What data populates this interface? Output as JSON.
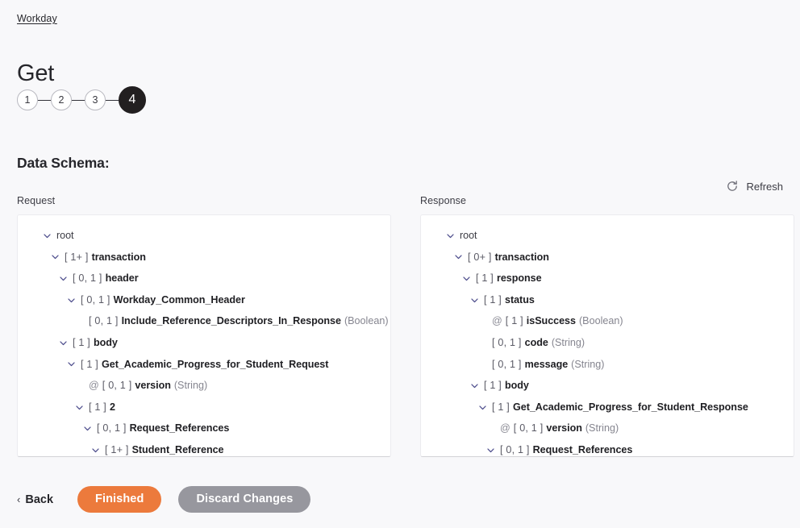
{
  "breadcrumb": {
    "label": "Workday"
  },
  "title": "Get",
  "stepper": {
    "steps": [
      {
        "label": "1",
        "active": false
      },
      {
        "label": "2",
        "active": false
      },
      {
        "label": "3",
        "active": false
      },
      {
        "label": "4",
        "active": true
      }
    ]
  },
  "section": {
    "heading": "Data Schema:"
  },
  "toolbar": {
    "refresh_label": "Refresh",
    "refresh_icon": "refresh-icon"
  },
  "colors": {
    "page_background": "#f8f8fa",
    "panel_background": "#ffffff",
    "accent_primary": "#ec7a3c",
    "accent_secondary": "#97979e",
    "active_step": "#221f20",
    "card_text": "#5b5b66",
    "type_text": "#85858f"
  },
  "panels": [
    {
      "label": "Request",
      "rows": [
        {
          "indent": 0,
          "twisty": "chevron-down-icon",
          "at": false,
          "card": "",
          "name": "root",
          "plain": true,
          "type": ""
        },
        {
          "indent": 1,
          "twisty": "chevron-down-icon",
          "at": false,
          "card": "[ 1+ ]",
          "name": "transaction",
          "plain": false,
          "type": ""
        },
        {
          "indent": 2,
          "twisty": "chevron-down-icon",
          "at": false,
          "card": "[ 0, 1 ]",
          "name": "header",
          "plain": false,
          "type": ""
        },
        {
          "indent": 3,
          "twisty": "chevron-down-icon",
          "at": false,
          "card": "[ 0, 1 ]",
          "name": "Workday_Common_Header",
          "plain": false,
          "type": ""
        },
        {
          "indent": 4,
          "twisty": "none",
          "at": false,
          "card": "[ 0, 1 ]",
          "name": "Include_Reference_Descriptors_In_Response",
          "plain": false,
          "type": "(Boolean)"
        },
        {
          "indent": 2,
          "twisty": "chevron-down-icon",
          "at": false,
          "card": "[ 1 ]",
          "name": "body",
          "plain": false,
          "type": ""
        },
        {
          "indent": 3,
          "twisty": "chevron-down-icon",
          "at": false,
          "card": "[ 1 ]",
          "name": "Get_Academic_Progress_for_Student_Request",
          "plain": false,
          "type": ""
        },
        {
          "indent": 4,
          "twisty": "none",
          "at": true,
          "card": "[ 0, 1 ]",
          "name": "version",
          "plain": false,
          "type": "(String)"
        },
        {
          "indent": 4,
          "twisty": "chevron-down-icon",
          "at": false,
          "card": "[ 1 ]",
          "name": "2",
          "plain": false,
          "type": ""
        },
        {
          "indent": 5,
          "twisty": "chevron-down-icon",
          "at": false,
          "card": "[ 0, 1 ]",
          "name": "Request_References",
          "plain": false,
          "type": ""
        },
        {
          "indent": 6,
          "twisty": "chevron-down-icon",
          "at": false,
          "card": "[ 1+ ]",
          "name": "Student_Reference",
          "plain": false,
          "type": ""
        }
      ]
    },
    {
      "label": "Response",
      "rows": [
        {
          "indent": 0,
          "twisty": "chevron-down-icon",
          "at": false,
          "card": "",
          "name": "root",
          "plain": true,
          "type": ""
        },
        {
          "indent": 1,
          "twisty": "chevron-down-icon",
          "at": false,
          "card": "[ 0+ ]",
          "name": "transaction",
          "plain": false,
          "type": ""
        },
        {
          "indent": 2,
          "twisty": "chevron-down-icon",
          "at": false,
          "card": "[ 1 ]",
          "name": "response",
          "plain": false,
          "type": ""
        },
        {
          "indent": 3,
          "twisty": "chevron-down-icon",
          "at": false,
          "card": "[ 1 ]",
          "name": "status",
          "plain": false,
          "type": ""
        },
        {
          "indent": 4,
          "twisty": "none",
          "at": true,
          "card": "[ 1 ]",
          "name": "isSuccess",
          "plain": false,
          "type": "(Boolean)"
        },
        {
          "indent": 4,
          "twisty": "none",
          "at": false,
          "card": "[ 0, 1 ]",
          "name": "code",
          "plain": false,
          "type": "(String)"
        },
        {
          "indent": 4,
          "twisty": "none",
          "at": false,
          "card": "[ 0, 1 ]",
          "name": "message",
          "plain": false,
          "type": "(String)"
        },
        {
          "indent": 3,
          "twisty": "chevron-down-icon",
          "at": false,
          "card": "[ 1 ]",
          "name": "body",
          "plain": false,
          "type": ""
        },
        {
          "indent": 4,
          "twisty": "chevron-down-icon",
          "at": false,
          "card": "[ 1 ]",
          "name": "Get_Academic_Progress_for_Student_Response",
          "plain": false,
          "type": ""
        },
        {
          "indent": 5,
          "twisty": "none",
          "at": true,
          "card": "[ 0, 1 ]",
          "name": "version",
          "plain": false,
          "type": "(String)"
        },
        {
          "indent": 5,
          "twisty": "chevron-down-icon",
          "at": false,
          "card": "[ 0, 1 ]",
          "name": "Request_References",
          "plain": false,
          "type": ""
        }
      ]
    }
  ],
  "footer": {
    "back_label": "Back",
    "back_chevron": "‹",
    "finished_label": "Finished",
    "discard_label": "Discard Changes"
  }
}
